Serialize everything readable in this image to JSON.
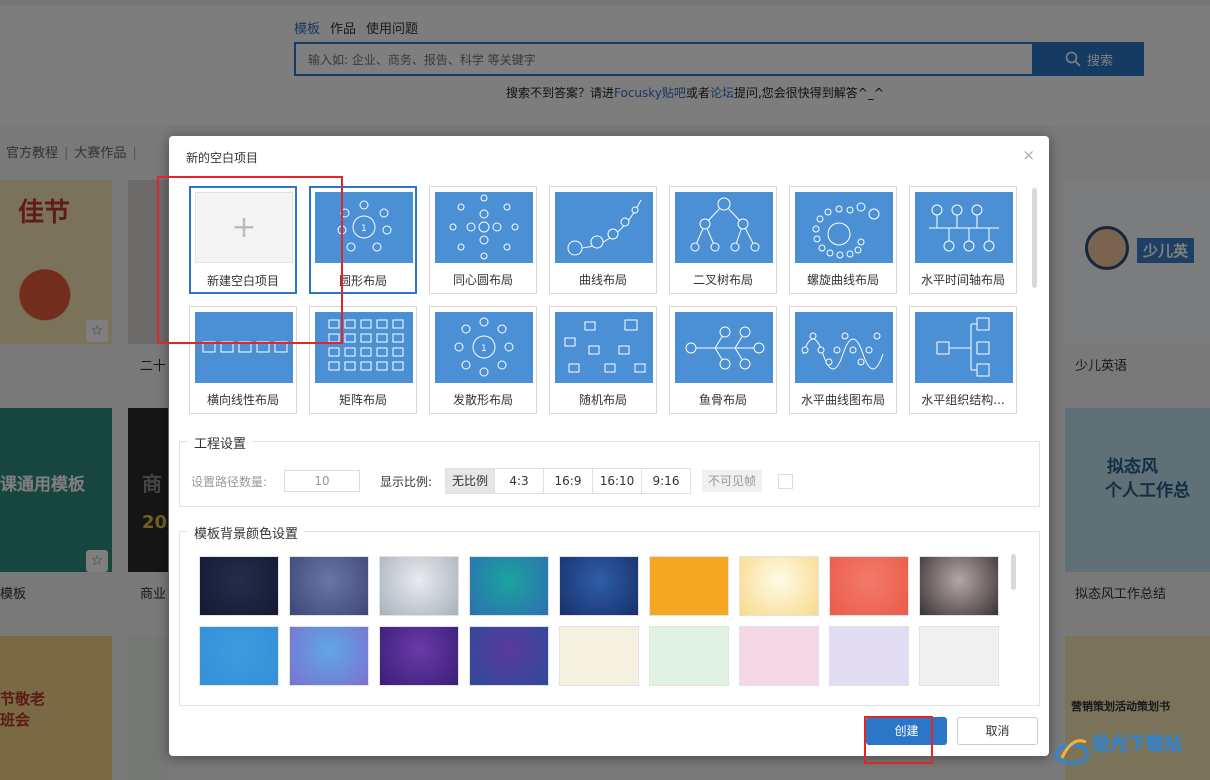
{
  "search": {
    "tabs": [
      "模板",
      "作品",
      "使用问题"
    ],
    "placeholder": "输入如: 企业、商务、报告、科学 等关键字",
    "button_label": "搜索",
    "help_prefix": "搜索不到答案？请进",
    "help_link1": "Focusky贴吧",
    "help_mid": "或者",
    "help_link2": "论坛",
    "help_suffix": "提问,您会很快得到解答^_^"
  },
  "categories": [
    "官方教程",
    "大赛作品"
  ],
  "cards": {
    "left_labels": [
      "二十",
      "商业",
      "模板"
    ],
    "right_labels": [
      "少儿英语",
      "拟态风工作总结"
    ],
    "thumb_texts": {
      "festival": "佳节",
      "course": "课通用模板",
      "respect": "节敬老\n班会",
      "kids": "少儿英",
      "mimic_title": "拟态风",
      "mimic_sub": "个人工作总",
      "marketing": "营销策划活动策划书",
      "business_letters": "商",
      "year": "20"
    }
  },
  "dialog": {
    "title": "新的空白项目",
    "close_symbol": "×",
    "layouts": [
      {
        "label": "新建空白项目",
        "icon": "plus-icon"
      },
      {
        "label": "圆形布局",
        "icon": "circle-layout-icon"
      },
      {
        "label": "同心圆布局",
        "icon": "concentric-layout-icon"
      },
      {
        "label": "曲线布局",
        "icon": "curve-layout-icon"
      },
      {
        "label": "二叉树布局",
        "icon": "binary-tree-layout-icon"
      },
      {
        "label": "螺旋曲线布局",
        "icon": "spiral-layout-icon"
      },
      {
        "label": "水平时间轴布局",
        "icon": "timeline-layout-icon"
      },
      {
        "label": "横向线性布局",
        "icon": "horizontal-linear-layout-icon"
      },
      {
        "label": "矩阵布局",
        "icon": "matrix-layout-icon"
      },
      {
        "label": "发散形布局",
        "icon": "radial-layout-icon"
      },
      {
        "label": "随机布局",
        "icon": "random-layout-icon"
      },
      {
        "label": "鱼骨布局",
        "icon": "fishbone-layout-icon"
      },
      {
        "label": "水平曲线图布局",
        "icon": "horizontal-curve-layout-icon"
      },
      {
        "label": "水平组织结构...",
        "icon": "org-chart-layout-icon"
      }
    ],
    "project_settings": {
      "title": "工程设置",
      "path_count_label": "设置路径数量:",
      "path_count_value": "10",
      "ratio_label": "显示比例:",
      "ratios": [
        "无比例",
        "4:3",
        "16:9",
        "16:10",
        "9:16"
      ],
      "selected_ratio": "无比例",
      "invisible_frame_label": "不可见帧"
    },
    "background": {
      "title": "模板背景颜色设置",
      "swatches": [
        {
          "from": "#252c4a",
          "to": "#141a33"
        },
        {
          "from": "#6a76a8",
          "to": "#3e4776"
        },
        {
          "from": "#e8ebef",
          "to": "#a8b1bb"
        },
        {
          "from": "#1aa39c",
          "to": "#2e6fb3"
        },
        {
          "from": "#2f5ea8",
          "to": "#17306a"
        },
        {
          "from": "#f5a623",
          "to": "#f5a623"
        },
        {
          "from": "#fffbe6",
          "to": "#f7d98b"
        },
        {
          "from": "#f27a6a",
          "to": "#ec5a4a"
        },
        {
          "from": "#b3a8a6",
          "to": "#3b3233"
        },
        {
          "from": "#3d9be0",
          "to": "#3590d6"
        },
        {
          "from": "#5fa6e6",
          "to": "#7b72d0"
        },
        {
          "from": "#6a3aa8",
          "to": "#3b1e78"
        },
        {
          "from": "#5a3a9e",
          "to": "#2e4a9a"
        },
        {
          "from": "#f5f0df",
          "to": "#f5f0df"
        },
        {
          "from": "#dff2e4",
          "to": "#dff2e4"
        },
        {
          "from": "#f5d8e6",
          "to": "#f5d8e6"
        },
        {
          "from": "#e2dcf2",
          "to": "#e2dcf2"
        },
        {
          "from": "#f0f0f0",
          "to": "#f0f0f0"
        }
      ]
    },
    "buttons": {
      "create": "创建",
      "cancel": "取消"
    }
  },
  "watermark": "极光下载站",
  "colors": {
    "accent": "#2b76c6",
    "highlight": "#e0262b",
    "layout_thumb": "#4b8fd4"
  }
}
